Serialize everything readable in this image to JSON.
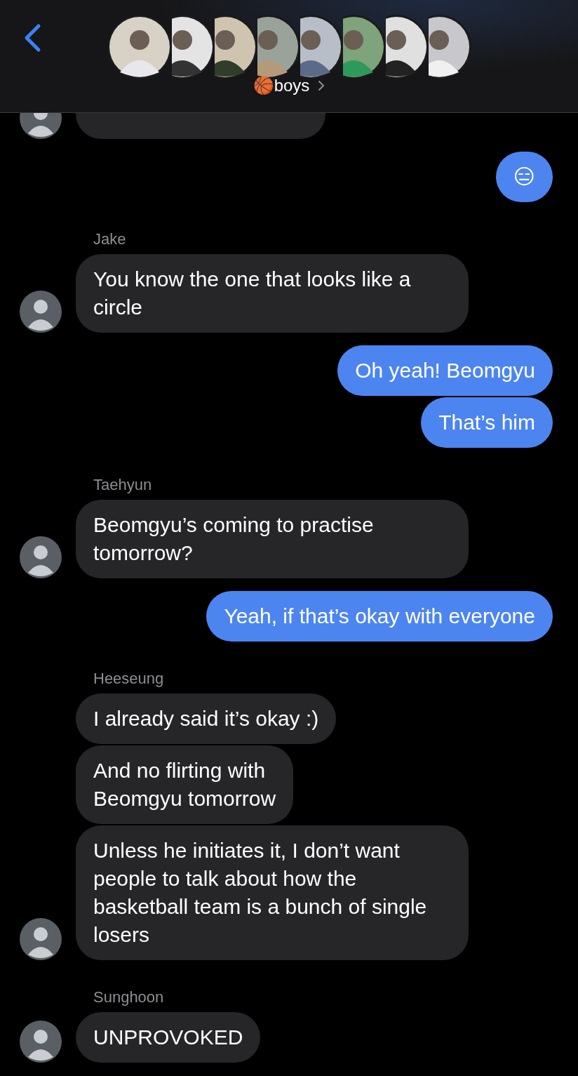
{
  "header": {
    "back": true,
    "group_name": "🏀boys"
  },
  "messages": [
    {
      "kind": "incoming",
      "avatar": true
    },
    {
      "kind": "outgoing",
      "text": "😑"
    },
    {
      "kind": "incoming",
      "sender": "Jake",
      "text": "You know the one that looks like a circle",
      "avatar": true
    },
    {
      "kind": "outgoing",
      "text": "Oh yeah! Beomgyu"
    },
    {
      "kind": "outgoing",
      "text": "That’s him"
    },
    {
      "kind": "incoming",
      "sender": "Taehyun",
      "text": "Beomgyu’s coming to practise tomorrow?",
      "avatar": true
    },
    {
      "kind": "outgoing",
      "text": "Yeah, if that’s okay with everyone"
    },
    {
      "kind": "incoming",
      "sender": "Heeseung",
      "text": "I already said it’s okay :)",
      "avatar": false
    },
    {
      "kind": "incoming",
      "text": "And no flirting with\nBeomgyu tomorrow",
      "avatar": false
    },
    {
      "kind": "incoming",
      "text": "Unless he initiates it, I don’t want people to talk about how the basketball team is a bunch of single losers",
      "avatar": true
    },
    {
      "kind": "incoming",
      "sender": "Sunghoon",
      "text": "UNPROVOKED",
      "avatar": true
    }
  ]
}
